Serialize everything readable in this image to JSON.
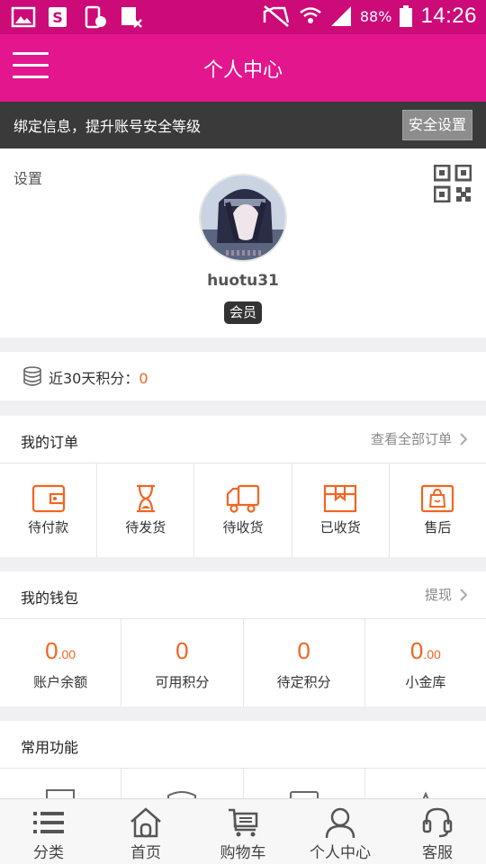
{
  "status_bar": {
    "battery": "88%",
    "time": "14:26"
  },
  "header": {
    "title": "个人中心"
  },
  "bind_bar": {
    "text": "绑定信息，提升账号安全等级",
    "button": "安全设置"
  },
  "profile": {
    "settings": "设置",
    "username": "huotu31",
    "badge": "会员"
  },
  "points": {
    "label": "近30天积分：",
    "value": "0"
  },
  "orders": {
    "title": "我的订单",
    "link": "查看全部订单",
    "items": [
      {
        "label": "待付款",
        "icon": "wallet-icon"
      },
      {
        "label": "待发货",
        "icon": "hourglass-icon"
      },
      {
        "label": "待收货",
        "icon": "truck-icon"
      },
      {
        "label": "已收货",
        "icon": "package-icon"
      },
      {
        "label": "售后",
        "icon": "bag-icon"
      }
    ]
  },
  "wallet": {
    "title": "我的钱包",
    "link": "提现",
    "items": [
      {
        "int": "0",
        "dec": ".00",
        "label": "账户余额"
      },
      {
        "int": "0",
        "dec": "",
        "label": "可用积分"
      },
      {
        "int": "0",
        "dec": "",
        "label": "待定积分"
      },
      {
        "int": "0",
        "dec": ".00",
        "label": "小金库"
      }
    ]
  },
  "common": {
    "title": "常用功能"
  },
  "tabbar": {
    "items": [
      {
        "label": "分类",
        "icon": "list-icon",
        "active": false
      },
      {
        "label": "首页",
        "icon": "home-icon",
        "active": false
      },
      {
        "label": "购物车",
        "icon": "cart-icon",
        "active": false
      },
      {
        "label": "个人中心",
        "icon": "person-icon",
        "active": true
      },
      {
        "label": "客服",
        "icon": "headset-icon",
        "active": false
      }
    ]
  },
  "colors": {
    "brand": "#e3168d",
    "status_bar": "#cc0a78",
    "accent": "#f26522",
    "bind_bar": "#3a3a3a"
  }
}
